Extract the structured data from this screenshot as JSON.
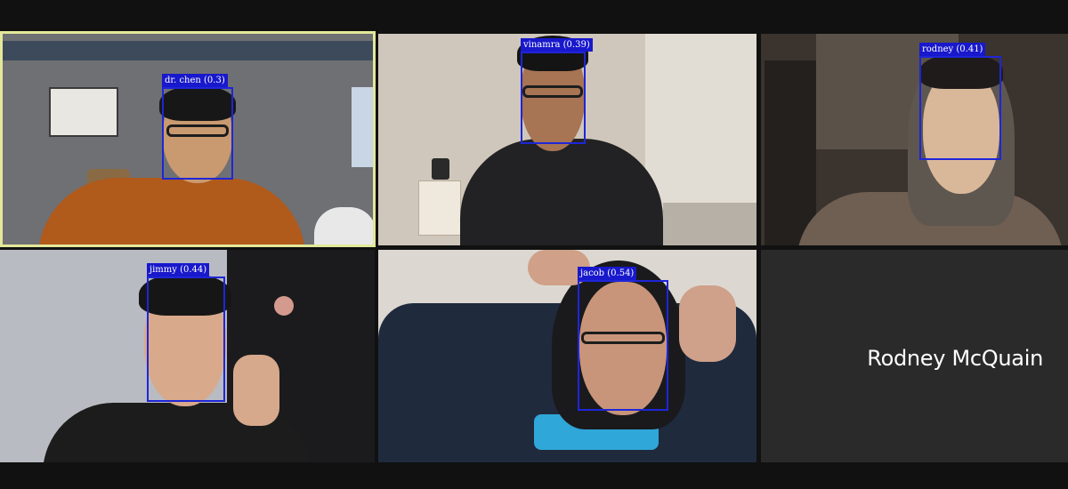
{
  "meeting": {
    "participants": [
      {
        "id": "dr-chen",
        "detection_label": "dr. chen (0.3)",
        "active_speaker": true
      },
      {
        "id": "vinamra",
        "detection_label": "vinamra (0.39)"
      },
      {
        "id": "rodney",
        "detection_label": "rodney (0.41)"
      },
      {
        "id": "jimmy",
        "detection_label": "jimmy (0.44)"
      },
      {
        "id": "jacob",
        "detection_label": "jacob (0.54)"
      }
    ],
    "video_off_tile": {
      "name": "Rodney McQuain"
    }
  },
  "colors": {
    "background": "#111111",
    "active_speaker_border": "#e3e89a",
    "detection_box": "#1e26d8",
    "detection_label_bg": "#1818cc",
    "empty_tile": "#2a2a2a"
  }
}
